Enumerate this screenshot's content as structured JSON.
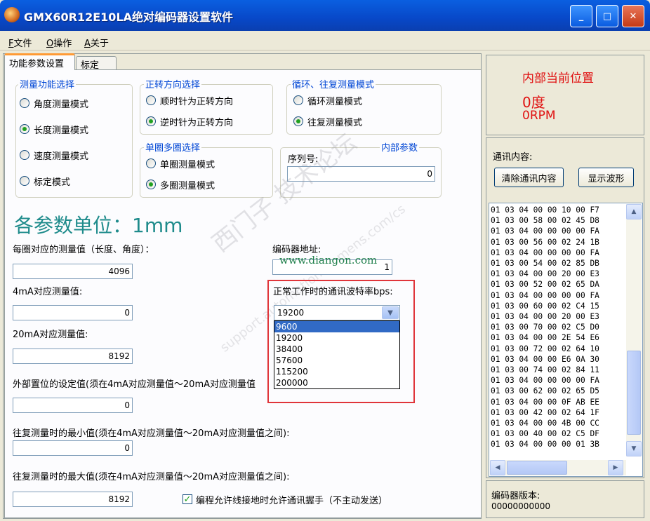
{
  "window": {
    "title": "GMX60R12E10LA绝对编码器设置软件",
    "min": "_",
    "max": "□",
    "close": "✕"
  },
  "menu": [
    {
      "hotkey": "F",
      "label": "文件"
    },
    {
      "hotkey": "O",
      "label": "操作"
    },
    {
      "hotkey": "A",
      "label": "关于"
    }
  ],
  "tabs": {
    "active": "功能参数设置",
    "inactive": "标定"
  },
  "measure_group": {
    "title": "测量功能选择",
    "options": [
      {
        "label": "角度测量模式",
        "checked": false
      },
      {
        "label": "长度测量模式",
        "checked": true
      },
      {
        "label": "速度测量模式",
        "checked": false
      },
      {
        "label": "标定模式",
        "checked": false
      }
    ]
  },
  "direction_group": {
    "title": "正转方向选择",
    "options": [
      {
        "label": "顺时针为正转方向",
        "checked": false
      },
      {
        "label": "逆时针为正转方向",
        "checked": true
      }
    ]
  },
  "cycle_group": {
    "title": "循环、往复测量模式",
    "options": [
      {
        "label": "循环测量模式",
        "checked": false
      },
      {
        "label": "往复测量模式",
        "checked": true
      }
    ]
  },
  "turn_group": {
    "title": "单圈多圈选择",
    "options": [
      {
        "label": "单圈测量模式",
        "checked": false
      },
      {
        "label": "多圈测量模式",
        "checked": true
      }
    ]
  },
  "internal_group": {
    "title": "内部参数",
    "serial_label": "序列号:",
    "serial_value": "0"
  },
  "units_label": "各参数单位：1mm",
  "fields": {
    "per_turn_label": "每圈对应的测量值（长度、角度）：",
    "per_turn_value": "4096",
    "ma4_label": "4mA对应测量值:",
    "ma4_value": "0",
    "ma20_label": "20mA对应测量值:",
    "ma20_value": "8192",
    "preset_label": "外部置位的设定值(须在4mA对应测量值～20mA对应测量值",
    "preset_value": "0",
    "min_label": "往复测量时的最小值(须在4mA对应测量值～20mA对应测量值之间):",
    "min_value": "0",
    "max_label": "往复测量时的最大值(须在4mA对应测量值～20mA对应测量值之间):",
    "max_value": "8192",
    "address_label": "编码器地址:",
    "address_value": "1"
  },
  "baud": {
    "label": "正常工作时的通讯波特率bps:",
    "selected": "19200",
    "options": [
      "9600",
      "19200",
      "38400",
      "57600",
      "115200",
      "200000"
    ],
    "highlighted": "9600"
  },
  "handshake": {
    "label": "编程允许线接地时允许通讯握手（不主动发送）",
    "checked": true
  },
  "watermark": {
    "main": "西门子   技术论坛",
    "sub": "support.automation.siemens.com/cs",
    "url": "www.diangon.com"
  },
  "position": {
    "title": "内部当前位置",
    "angle": "0度",
    "speed": "0RPM"
  },
  "comm": {
    "label": "通讯内容:",
    "clear_button": "清除通讯内容",
    "wave_button": "显示波形",
    "lines": [
      "01 03 04 00 00 10 00 F7",
      "01 03 00 58 00 02 45 D8",
      "01 03 04 00 00 00 00 FA",
      "01 03 00 56 00 02 24 1B",
      "01 03 04 00 00 00 00 FA",
      "01 03 00 54 00 02 85 DB",
      "01 03 04 00 00 20 00 E3",
      "01 03 00 52 00 02 65 DA",
      "01 03 04 00 00 00 00 FA",
      "01 03 00 60 00 02 C4 15",
      "01 03 04 00 00 20 00 E3",
      "01 03 00 70 00 02 C5 D0",
      "01 03 04 00 00 2E 54 E6",
      "01 03 00 72 00 02 64 10",
      "01 03 04 00 00 E6 0A 30",
      "01 03 00 74 00 02 84 11",
      "01 03 04 00 00 00 00 FA",
      "01 03 00 62 00 02 65 D5",
      "01 03 04 00 00 0F AB EE",
      "01 03 00 42 00 02 64 1F",
      "01 03 04 00 00 4B 00 CC",
      "01 03 00 40 00 02 C5 DF",
      "01 03 04 00 00 00 01 3B"
    ]
  },
  "version": {
    "label": "编码器版本:",
    "value": "00000000000"
  },
  "colors": {
    "accent_blue": "#0046d5",
    "alert_red": "#e01010",
    "frame_red": "#e0353a"
  }
}
